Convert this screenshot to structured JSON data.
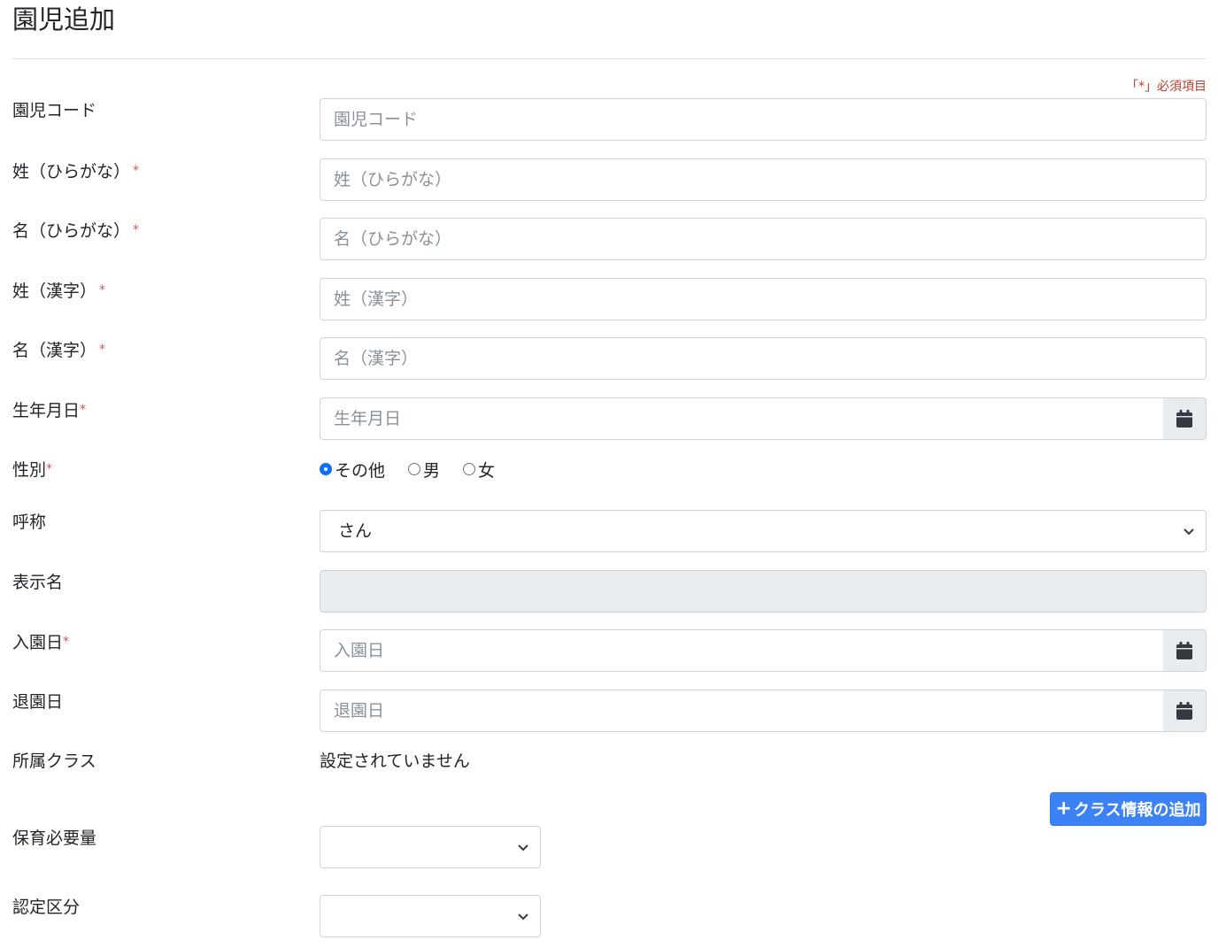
{
  "page": {
    "title": "園児追加",
    "required_note": "「*」必須項目"
  },
  "form": {
    "child_code": {
      "label": "園児コード",
      "placeholder": "園児コード",
      "value": ""
    },
    "last_kana": {
      "label": "姓（ひらがな）",
      "placeholder": "姓（ひらがな）",
      "value": ""
    },
    "first_kana": {
      "label": "名（ひらがな）",
      "placeholder": "名（ひらがな）",
      "value": ""
    },
    "last_kanji": {
      "label": "姓（漢字）",
      "placeholder": "姓（漢字）",
      "value": ""
    },
    "first_kanji": {
      "label": "名（漢字）",
      "placeholder": "名（漢字）",
      "value": ""
    },
    "birthdate": {
      "label": "生年月日",
      "placeholder": "生年月日",
      "value": ""
    },
    "gender": {
      "label": "性別",
      "options": [
        {
          "label": "その他",
          "checked": true
        },
        {
          "label": "男",
          "checked": false
        },
        {
          "label": "女",
          "checked": false
        }
      ]
    },
    "honorific": {
      "label": "呼称",
      "selected": "さん"
    },
    "display_name": {
      "label": "表示名",
      "value": ""
    },
    "enroll_date": {
      "label": "入園日",
      "placeholder": "入園日",
      "value": ""
    },
    "leave_date": {
      "label": "退園日",
      "placeholder": "退園日",
      "value": ""
    },
    "class_affiliation": {
      "label": "所属クラス",
      "value": "設定されていません"
    },
    "add_class_button": {
      "label": "クラス情報の追加",
      "icon": "plus-icon"
    },
    "care_need": {
      "label": "保育必要量",
      "selected": ""
    },
    "certification": {
      "label": "認定区分",
      "selected": ""
    }
  },
  "colors": {
    "primary": "#3b82f6",
    "required": "#d9534f",
    "border": "#ced4da",
    "disabled": "#e9ecef"
  },
  "required_mark": "*"
}
